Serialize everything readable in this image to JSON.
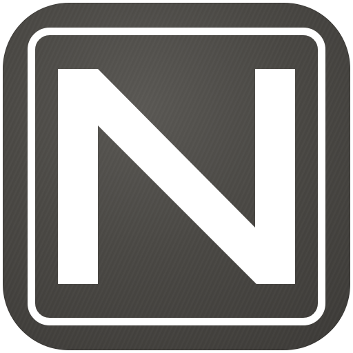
{
  "icon": {
    "letter": "N",
    "colors": {
      "tile": "#4a4844",
      "foreground": "#ffffff"
    }
  }
}
